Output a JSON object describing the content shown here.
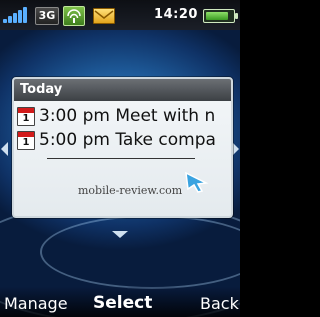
{
  "status_bar": {
    "network_label": "3G",
    "time": "14:20",
    "signal_icon": "signal-strength-icon",
    "wifi_icon": "wifi-icon",
    "message_icon": "envelope-icon",
    "battery_icon": "battery-icon",
    "battery_level": 0.85
  },
  "widget": {
    "title": "Today",
    "events": [
      {
        "icon": "calendar-icon",
        "icon_date": "1",
        "text": "3:00 pm Meet with n"
      },
      {
        "icon": "calendar-icon",
        "icon_date": "1",
        "text": "5:00 pm Take compa"
      }
    ],
    "watermark": "mobile-review.com"
  },
  "softkeys": {
    "left": "Manage",
    "center": "Select",
    "right": "Back"
  },
  "colors": {
    "accent_red": "#d21b1b",
    "header_gray": "#4a4e53",
    "background_blue": "#1f5e9e"
  }
}
